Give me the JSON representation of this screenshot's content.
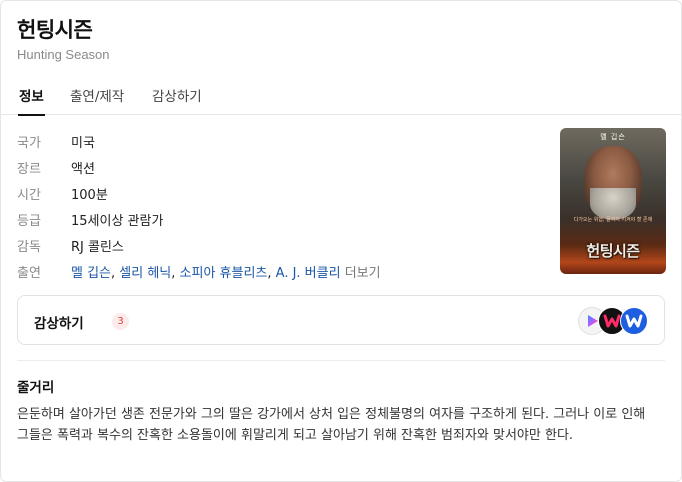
{
  "movie": {
    "title": "헌팅시즌",
    "original_title": "Hunting Season"
  },
  "tabs": [
    {
      "label": "정보",
      "active": true
    },
    {
      "label": "출연/제작",
      "active": false
    },
    {
      "label": "감상하기",
      "active": false
    }
  ],
  "info": {
    "country": {
      "label": "국가",
      "value": "미국"
    },
    "genre": {
      "label": "장르",
      "value": "액션"
    },
    "runtime": {
      "label": "시간",
      "value": "100분"
    },
    "rating": {
      "label": "등급",
      "value": "15세이상 관람가"
    },
    "director": {
      "label": "감독",
      "value": "RJ 콜린스"
    },
    "cast": {
      "label": "출연",
      "names": [
        "멜 깁슨",
        "셀리 헤닉",
        "소피아 휴블리츠",
        "A. J. 버클리"
      ],
      "separator": ", ",
      "more_label": "더보기"
    }
  },
  "poster": {
    "top_text": "멜 깁슨",
    "tagline": "다가오는 위협, 끝까지 지켜야 할 존재",
    "title_text": "헌팅시즌"
  },
  "watch": {
    "label": "감상하기",
    "count": "3",
    "services": [
      {
        "name": "play-service",
        "icon": "play-triangle-icon",
        "color": "#f4f4f6"
      },
      {
        "name": "watcha-service",
        "icon": "w-logo-icon",
        "color": "#111111"
      },
      {
        "name": "wavve-service",
        "icon": "w-logo-icon",
        "color": "#1d5fe0"
      }
    ]
  },
  "plot": {
    "heading": "줄거리",
    "text": "은둔하며 살아가던 생존 전문가와 그의 딸은 강가에서 상처 입은 정체불명의 여자를 구조하게 된다. 그러나 이로 인해 그들은 폭력과 복수의 잔혹한 소용돌이에 휘말리게 되고 살아남기 위해 잔혹한 범죄자와 맞서야만 한다."
  },
  "colors": {
    "link": "#1a56a6",
    "badge_text": "#e0463a",
    "badge_bg": "#fdeaea",
    "muted": "#8a8a8a"
  }
}
